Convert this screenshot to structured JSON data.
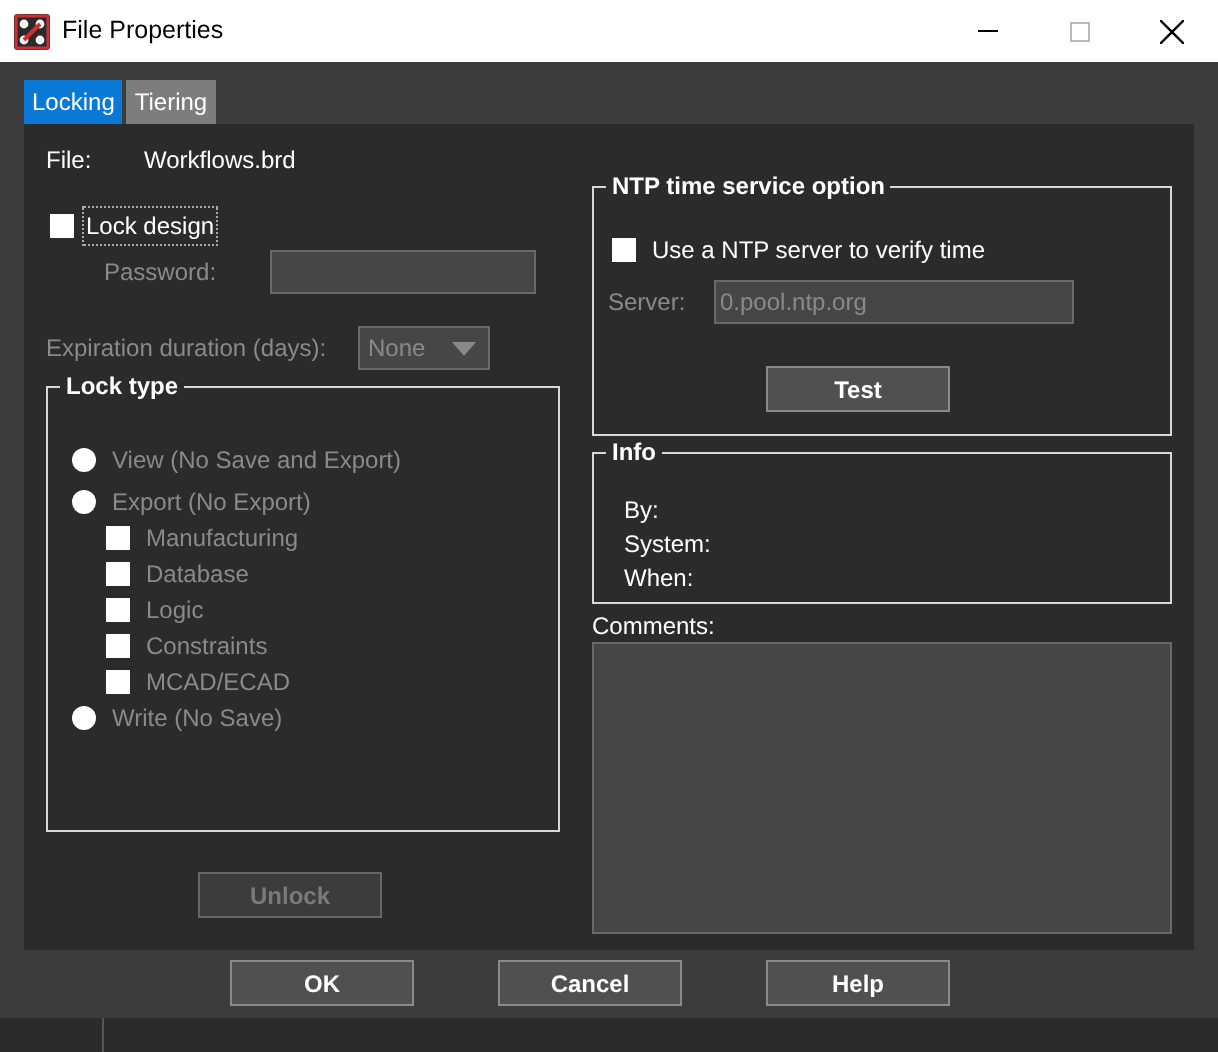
{
  "window": {
    "title": "File Properties"
  },
  "tabs": [
    {
      "label": "Locking",
      "selected": true
    },
    {
      "label": "Tiering",
      "selected": false
    }
  ],
  "file": {
    "label": "File:",
    "value": "Workflows.brd"
  },
  "lock_design": {
    "label": "Lock design",
    "checked": false
  },
  "password": {
    "label": "Password:",
    "disabled": true
  },
  "expiration": {
    "label": "Expiration duration (days):",
    "value": "None",
    "disabled": true
  },
  "lock_type": {
    "title": "Lock type",
    "disabled": true,
    "options": [
      {
        "kind": "radio",
        "label": "View (No Save and Export)",
        "selected": false
      },
      {
        "kind": "radio",
        "label": "Export (No Export)",
        "selected": false
      },
      {
        "kind": "checkbox",
        "label": "Manufacturing",
        "checked": false
      },
      {
        "kind": "checkbox",
        "label": "Database",
        "checked": false
      },
      {
        "kind": "checkbox",
        "label": "Logic",
        "checked": false
      },
      {
        "kind": "checkbox",
        "label": "Constraints",
        "checked": false
      },
      {
        "kind": "checkbox",
        "label": "MCAD/ECAD",
        "checked": false
      },
      {
        "kind": "radio",
        "label": "Write (No Save)",
        "selected": false
      }
    ]
  },
  "unlock_button": {
    "label": "Unlock",
    "disabled": true
  },
  "ntp": {
    "title": "NTP time service option",
    "use_server": {
      "label": "Use a NTP server to verify time",
      "checked": false
    },
    "server": {
      "label": "Server:",
      "value": "0.pool.ntp.org",
      "disabled": true
    },
    "test_button": "Test"
  },
  "info": {
    "title": "Info",
    "fields": [
      "By:",
      "System:",
      "When:"
    ]
  },
  "comments": {
    "label": "Comments:"
  },
  "buttons": [
    "OK",
    "Cancel",
    "Help"
  ]
}
